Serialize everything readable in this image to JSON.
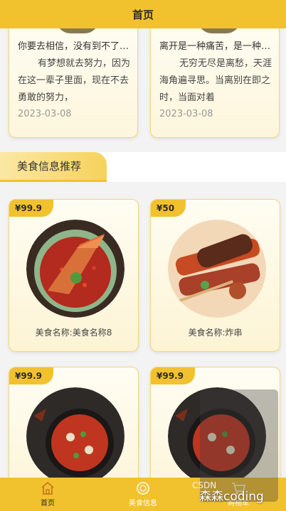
{
  "header": {
    "title": "首页"
  },
  "news": [
    {
      "title": "你要去相信，没有到不了的明天",
      "desc": "有梦想就去努力，因为在这一辈子里面，现在不去勇敢的努力，",
      "date": "2023-03-08"
    },
    {
      "title": "离开是一种痛苦，是一种难舍",
      "desc": "无穷无尽是离愁，天涯海角遍寻思。当离别在即之时，当面对着",
      "date": "2023-03-08"
    }
  ],
  "section": {
    "title": "美食信息推荐"
  },
  "foods": [
    {
      "price": "¥99.9",
      "name": "美食名称:美食名称8"
    },
    {
      "price": "¥50",
      "name": "美食名称:炸串"
    },
    {
      "price": "¥99.9",
      "name": ""
    },
    {
      "price": "¥99.9",
      "name": ""
    }
  ],
  "tabbar": [
    {
      "label": "首页",
      "icon": "home-icon",
      "active": true
    },
    {
      "label": "美食信息",
      "icon": "food-icon",
      "active": false
    },
    {
      "label": "购物车",
      "icon": "cart-icon",
      "active": false
    }
  ],
  "watermark": {
    "csdn": "CSDN",
    "author": "森森coding"
  },
  "colors": {
    "accent": "#f2c12e",
    "card_border": "#f2d77a"
  }
}
